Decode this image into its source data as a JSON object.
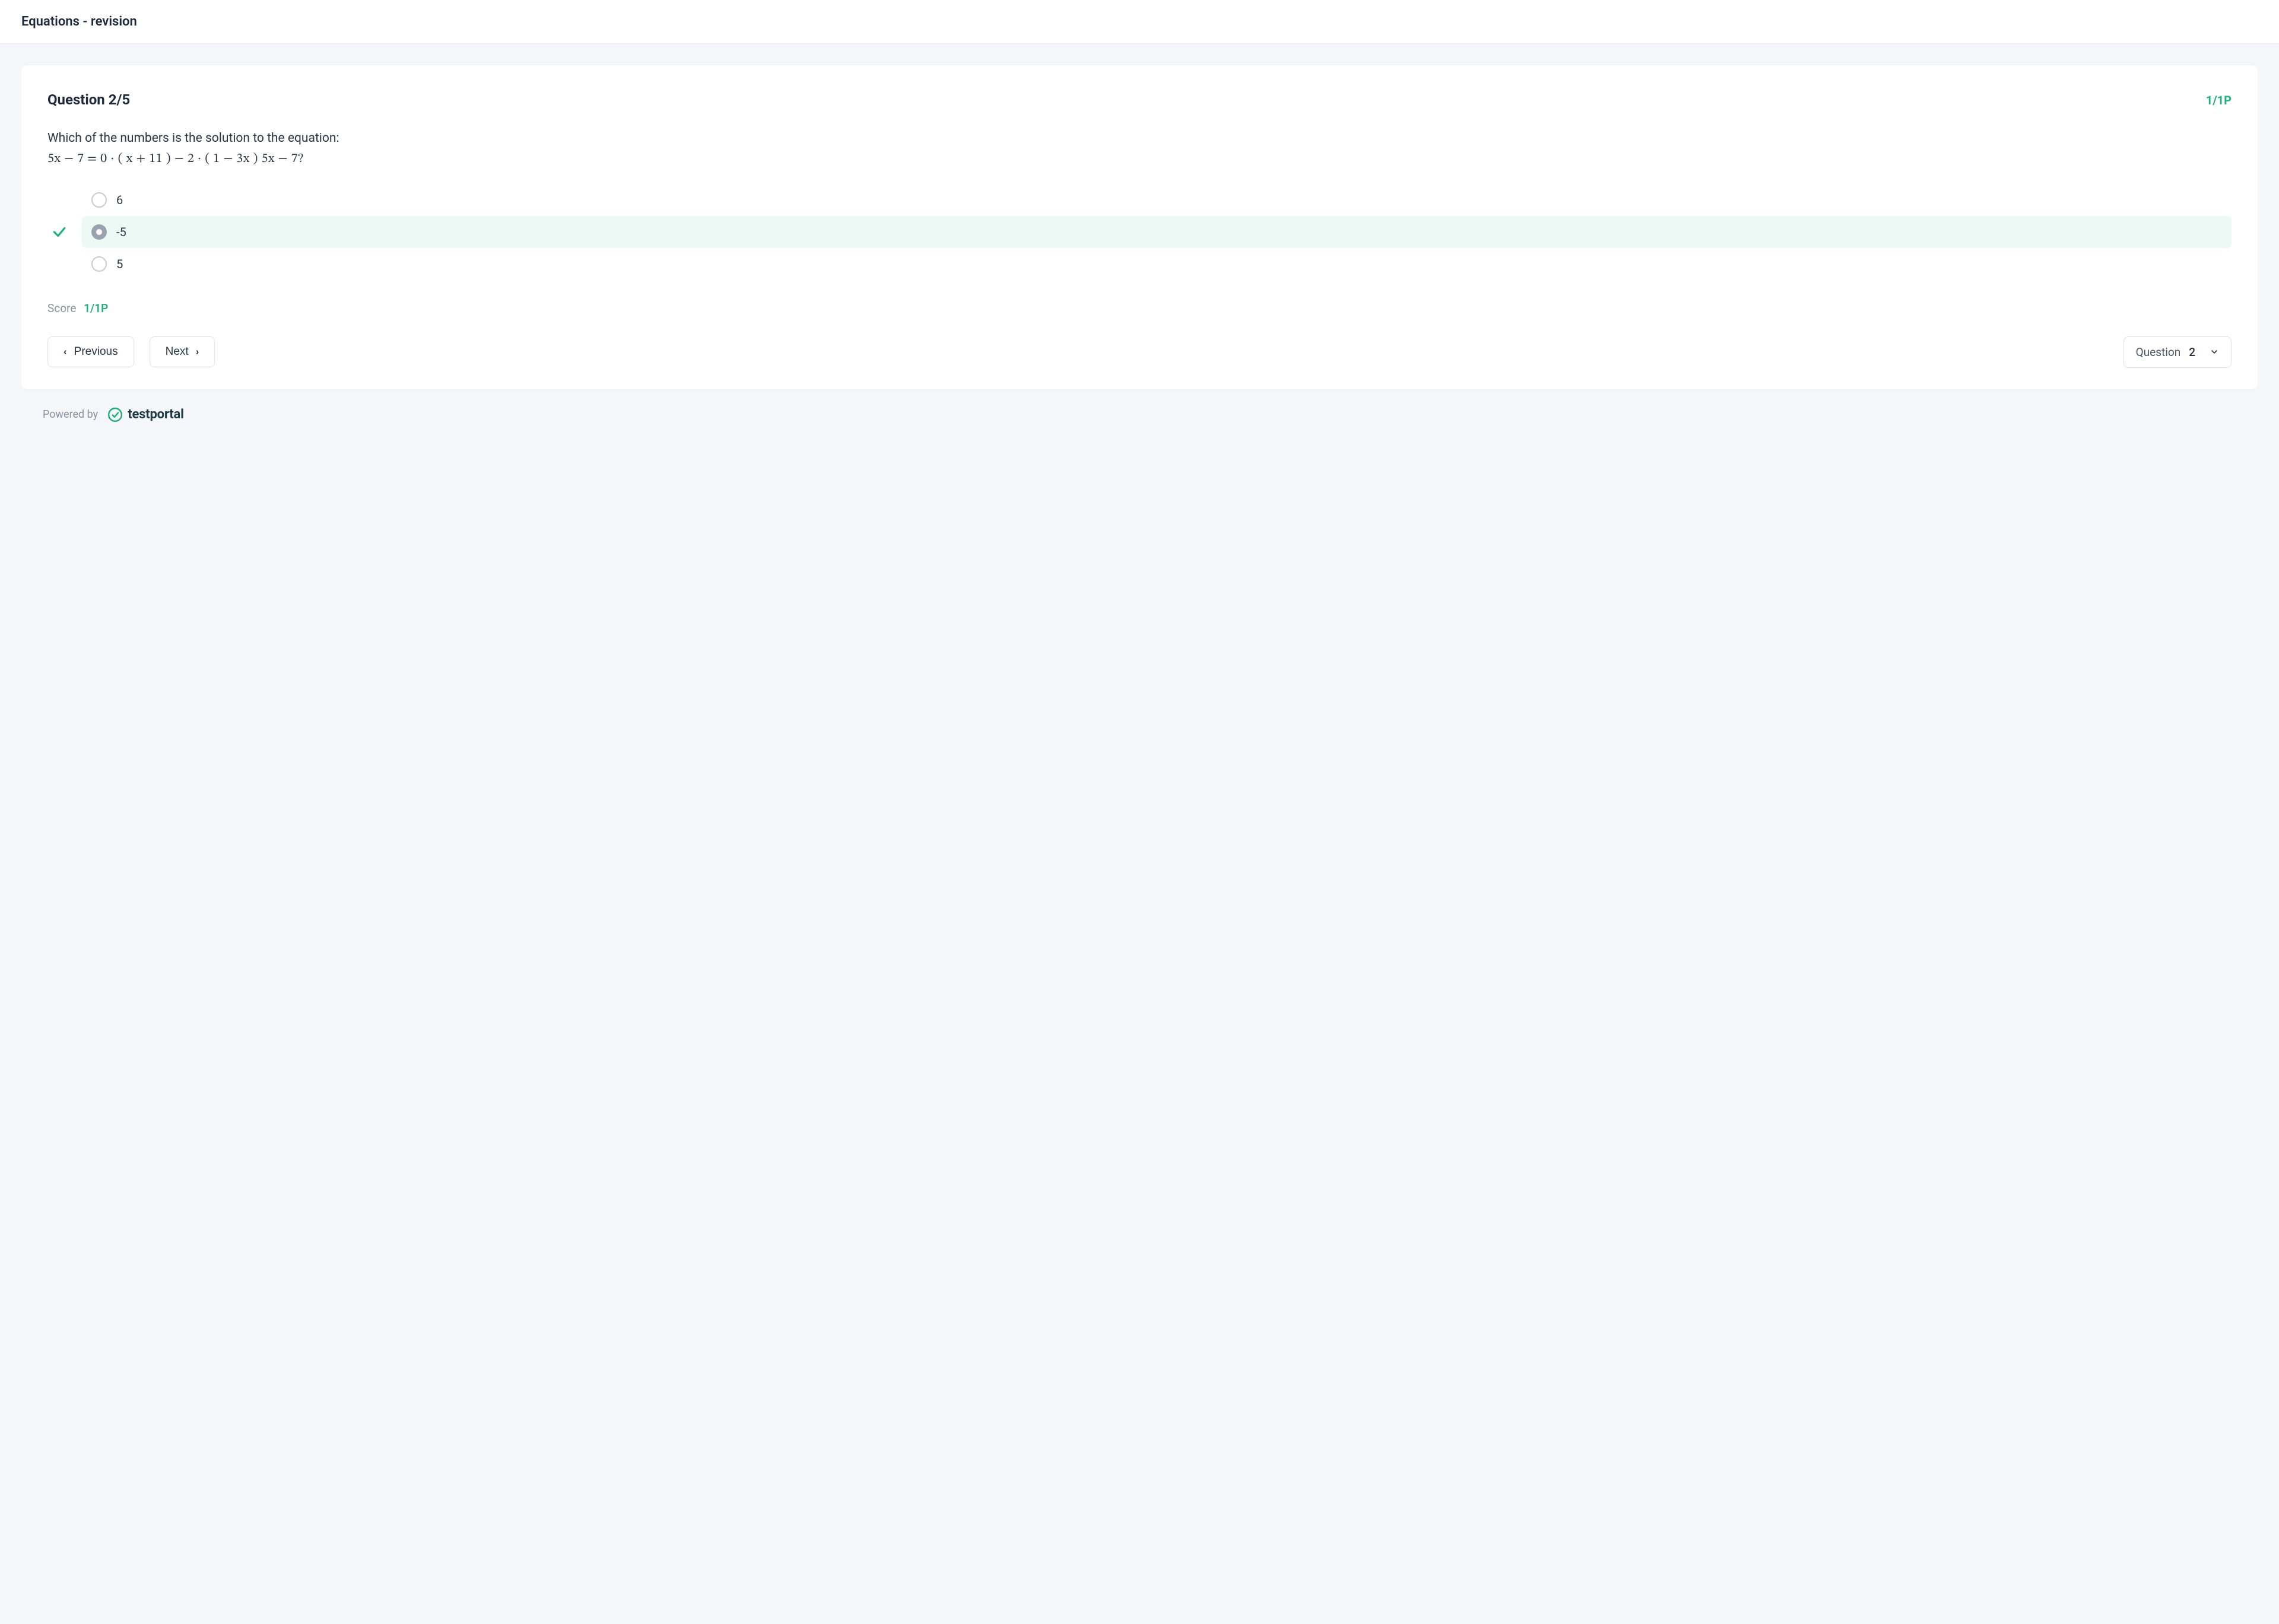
{
  "header": {
    "title": "Equations - revision"
  },
  "question": {
    "label": "Question 2/5",
    "points": "1/1P",
    "text": "Which of the numbers is the solution to the equation:",
    "equation": "5x − 7 = 0 · ( x + 11 ) − 2 · ( 1 − 3x ) 5x − 7?",
    "options": [
      {
        "label": "6",
        "selected": false,
        "correct": false
      },
      {
        "label": "-5",
        "selected": true,
        "correct": true
      },
      {
        "label": "5",
        "selected": false,
        "correct": false
      }
    ],
    "score_label": "Score",
    "score_value": "1/1P"
  },
  "nav": {
    "previous": "Previous",
    "next": "Next",
    "select_label": "Question",
    "select_value": "2"
  },
  "footer": {
    "powered_by": "Powered by",
    "brand": "testportal"
  }
}
